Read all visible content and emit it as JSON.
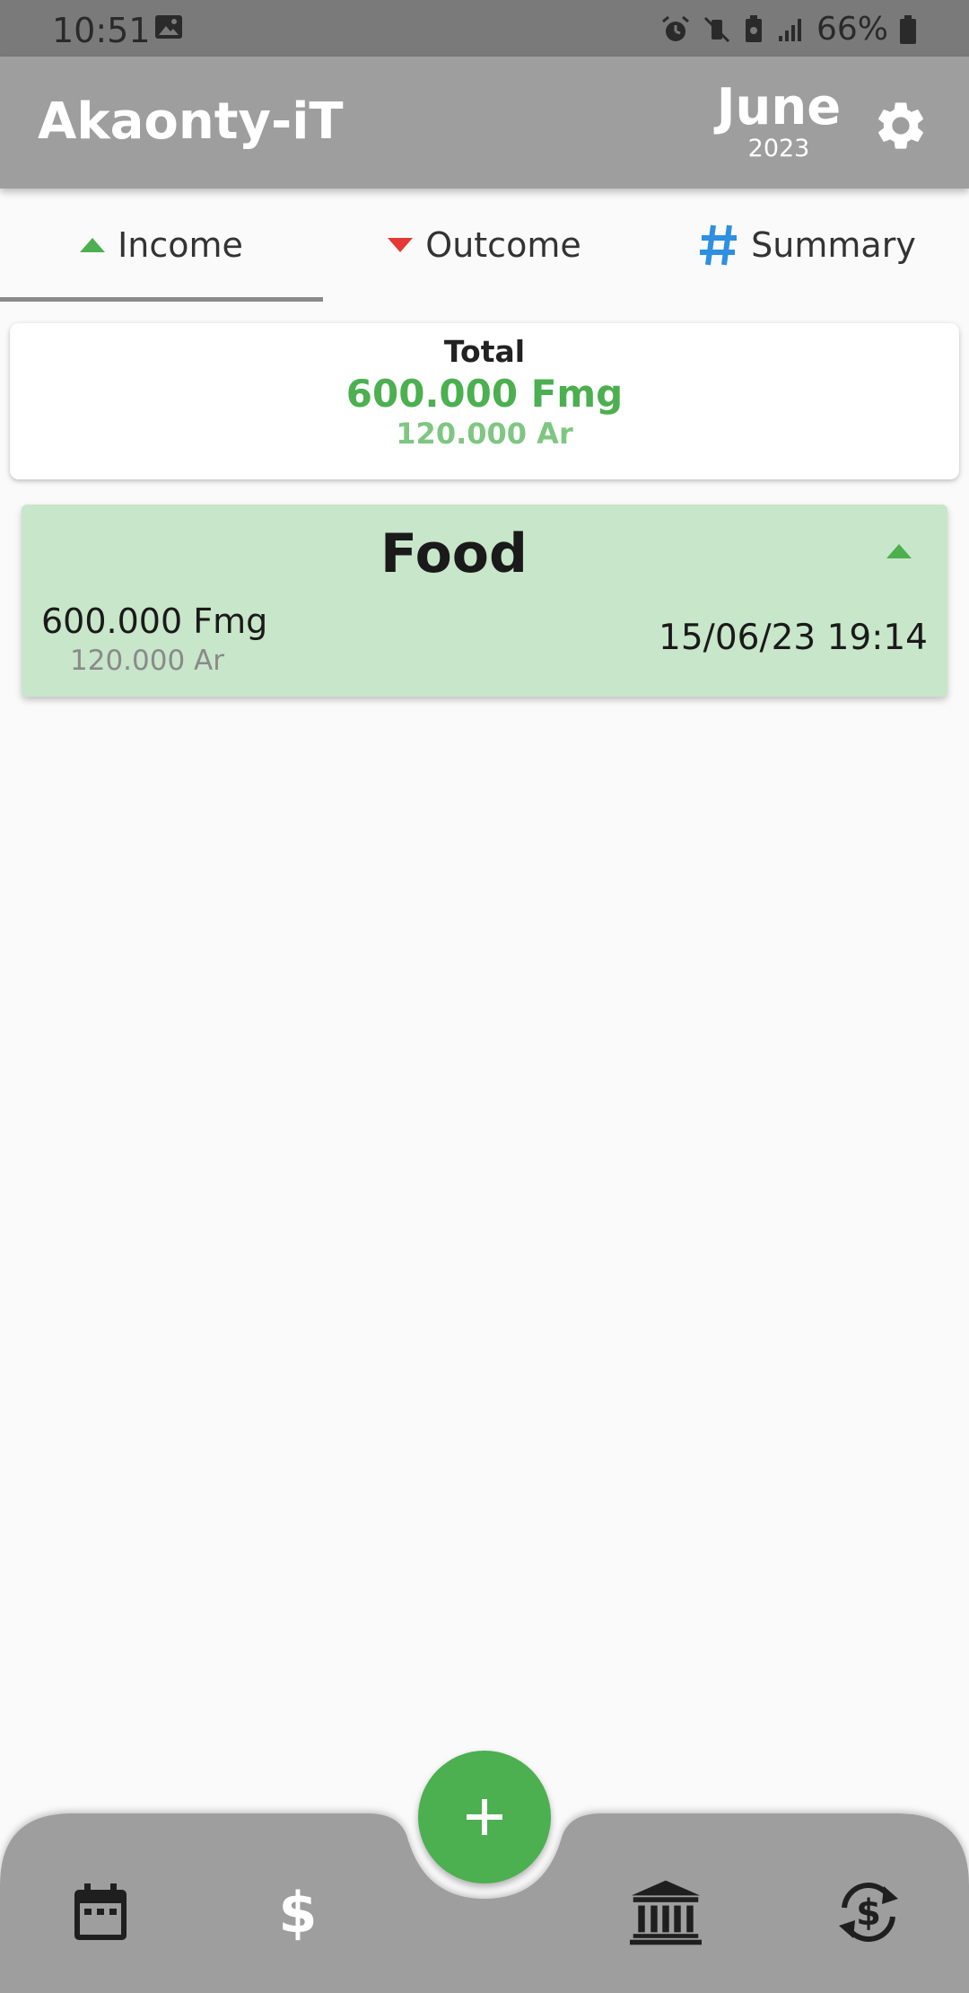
{
  "status_bar": {
    "time": "10:51",
    "battery": "66%"
  },
  "app": {
    "title": "Akaonty-iT"
  },
  "period": {
    "month": "June",
    "year": "2023"
  },
  "tabs": [
    {
      "label": "Income",
      "icon": "triangle-up-icon",
      "active": true
    },
    {
      "label": "Outcome",
      "icon": "triangle-down-icon",
      "active": false
    },
    {
      "label": "Summary",
      "icon": "hash-icon",
      "active": false
    }
  ],
  "total": {
    "label": "Total",
    "fmg": "600.000 Fmg",
    "ar": "120.000 Ar"
  },
  "entries": [
    {
      "title": "Food",
      "fmg": "600.000 Fmg",
      "ar": "120.000 Ar",
      "datetime": "15/06/23 19:14"
    }
  ],
  "bottom_nav": {
    "items": [
      "calendar-icon",
      "dollar-icon",
      "bank-icon",
      "currency-exchange-icon"
    ],
    "fab": "add-icon"
  },
  "colors": {
    "app_bar": "#9e9e9e",
    "accent_green": "#4caf50",
    "outcome_red": "#e53935",
    "summary_blue": "#2f8fe0",
    "entry_bg": "#c8e6c9"
  }
}
